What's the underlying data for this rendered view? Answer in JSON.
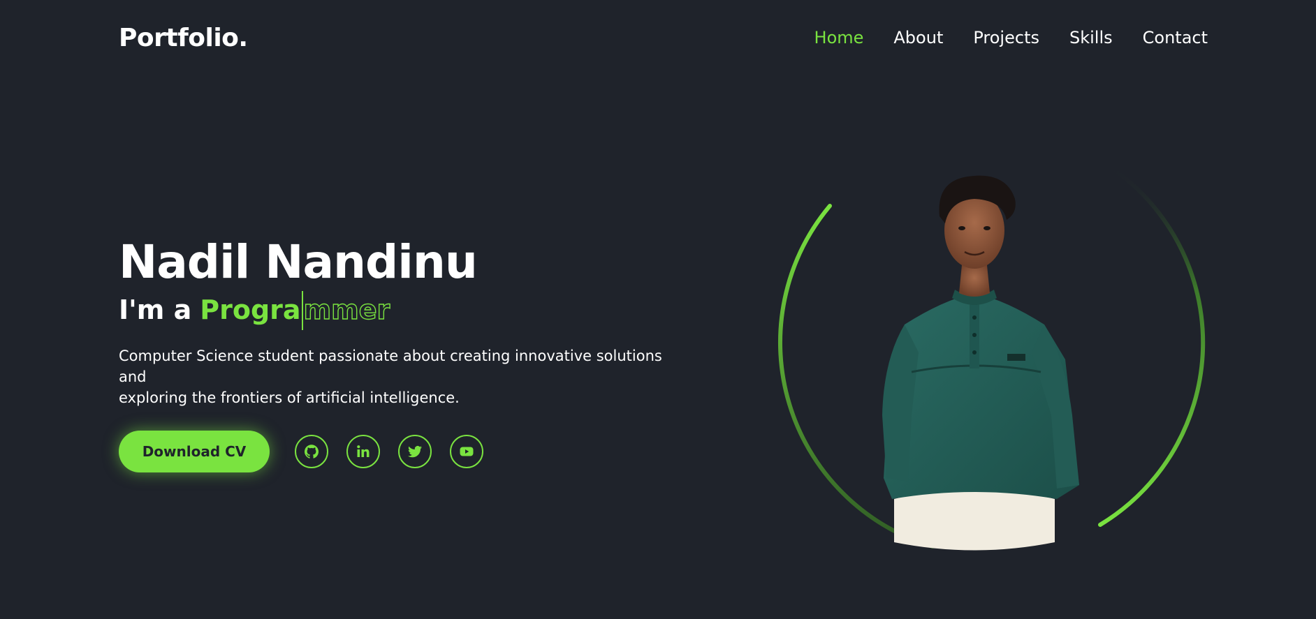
{
  "header": {
    "logo": "Portfolio.",
    "nav": [
      {
        "label": "Home",
        "active": true
      },
      {
        "label": "About",
        "active": false
      },
      {
        "label": "Projects",
        "active": false
      },
      {
        "label": "Skills",
        "active": false
      },
      {
        "label": "Contact",
        "active": false
      }
    ]
  },
  "hero": {
    "name": "Nadil Nandinu",
    "role_prefix": "I'm a",
    "role_typed": "Progra",
    "role_rest": "mmer",
    "description_line1": "Computer Science student passionate about creating innovative solutions and",
    "description_line2": "exploring the frontiers of artificial intelligence.",
    "cv_button": "Download CV",
    "socials": [
      {
        "icon": "github-icon"
      },
      {
        "icon": "linkedin-icon"
      },
      {
        "icon": "twitter-icon"
      },
      {
        "icon": "youtube-icon"
      }
    ]
  },
  "theme": {
    "background": "#1f232b",
    "accent": "#7ae340",
    "text": "#ffffff"
  }
}
